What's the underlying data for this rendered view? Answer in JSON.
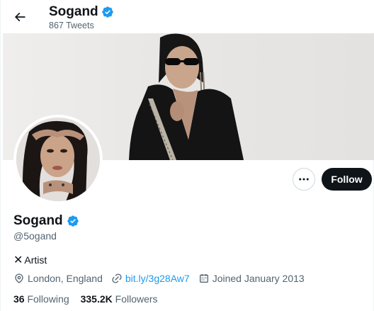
{
  "header": {
    "name": "Sogand",
    "tweet_count": "867 Tweets"
  },
  "profile": {
    "name": "Sogand",
    "handle": "@5ogand",
    "bio_text": "Artist",
    "location": "London, England",
    "link": "bit.ly/3g28Aw7",
    "joined": "Joined January 2013",
    "following_count": "36",
    "following_label": "Following",
    "followers_count": "335.2K",
    "followers_label": "Followers"
  },
  "buttons": {
    "follow_label": "Follow"
  },
  "icons": {
    "back": "arrow-left-icon",
    "verified": "verified-badge-icon",
    "more": "more-horizontal-icon",
    "bio_prefix": "cross-mark-icon",
    "location": "location-pin-icon",
    "link": "link-icon",
    "calendar": "calendar-icon"
  },
  "colors": {
    "accent": "#1d9bf0",
    "text": "#0f1419",
    "secondary": "#536471",
    "follow_button": "#0f1419"
  }
}
